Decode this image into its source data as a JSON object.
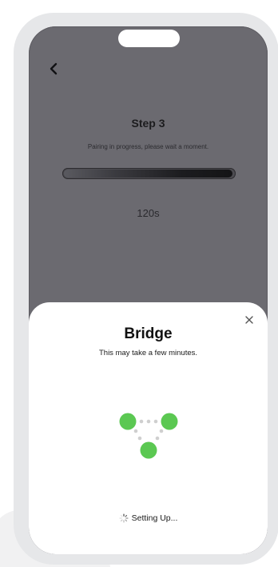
{
  "screen": {
    "step_title": "Step 3",
    "step_subtitle": "Pairing in progress, please wait a moment.",
    "progress_fraction": 0.99,
    "timer_text": "120s",
    "back_icon": "chevron-left-icon"
  },
  "sheet": {
    "title": "Bridge",
    "subtitle": "This may take a few minutes.",
    "status_text": "Setting Up...",
    "close_icon": "close-icon",
    "accent_color": "#5bc852"
  },
  "colors": {
    "screen_background": "#6b6a70",
    "frame": "#e6e7e9",
    "sheet_background": "#ffffff"
  }
}
